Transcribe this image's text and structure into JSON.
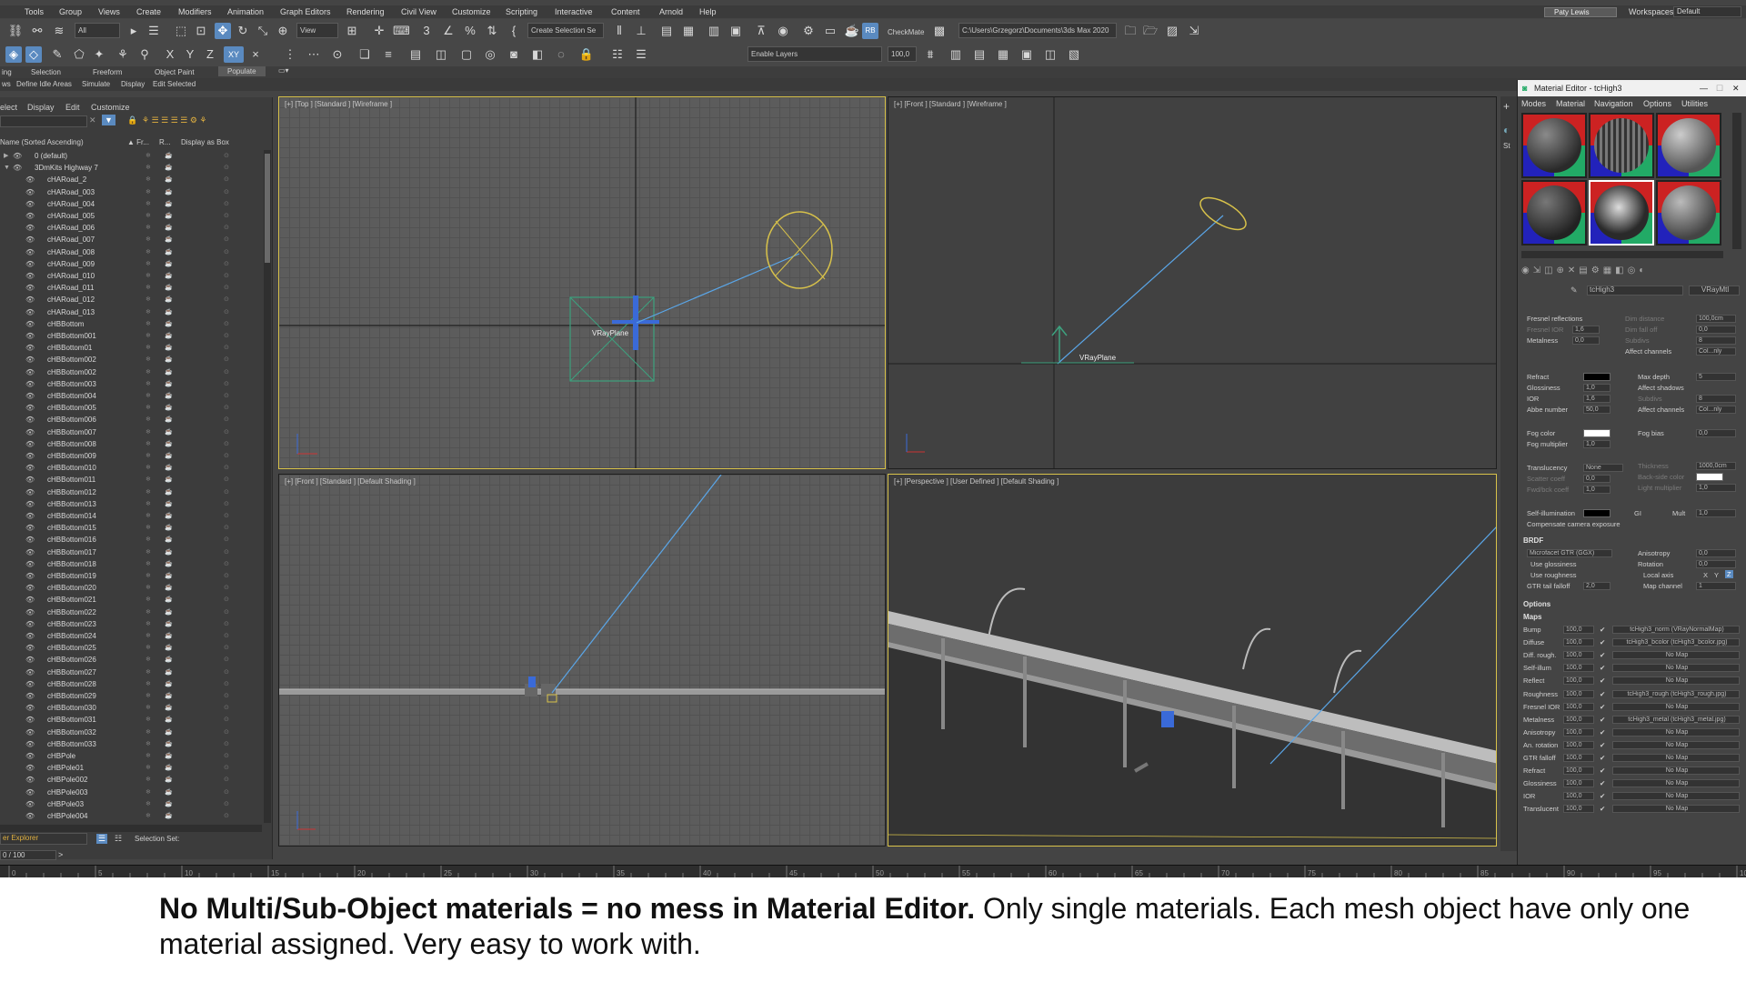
{
  "menu": [
    "Tools",
    "Group",
    "Views",
    "Create",
    "Modifiers",
    "Animation",
    "Graph Editors",
    "Rendering",
    "Civil View",
    "Customize",
    "Scripting",
    "Interactive",
    "Content",
    "Arnold",
    "Help"
  ],
  "user": {
    "name": "Paty Lewis",
    "workspaces_label": "Workspaces:",
    "workspace": "Default"
  },
  "toolbar": {
    "filter": "All",
    "view": "View",
    "selection_set": "Create Selection Se",
    "checkmate": "CheckMate",
    "path": "C:\\Users\\Grzegorz\\Documents\\3ds Max 2020",
    "enable_layers": "Enable Layers",
    "value": "100,0",
    "xyz": [
      "X",
      "Y",
      "Z",
      "XY"
    ]
  },
  "ribbon": {
    "tabs": [
      "ing",
      "Selection",
      "Freeform",
      "Object Paint",
      "Populate"
    ],
    "sub": [
      "ws",
      "Define Idle Areas",
      "Simulate",
      "Display",
      "Edit Selected"
    ]
  },
  "scene": {
    "tabs": [
      "elect",
      "Display",
      "Edit",
      "Customize"
    ],
    "headers": {
      "name": "Name (Sorted Ascending)",
      "fr": "▲ Fr...",
      "r": "R...",
      "display": "Display as Box"
    },
    "rows": [
      "0 (default)",
      "3DmKits Highway 7",
      "cHARoad_2",
      "cHARoad_003",
      "cHARoad_004",
      "cHARoad_005",
      "cHARoad_006",
      "cHARoad_007",
      "cHARoad_008",
      "cHARoad_009",
      "cHARoad_010",
      "cHARoad_011",
      "cHARoad_012",
      "cHARoad_013",
      "cHBBottom",
      "cHBBottom001",
      "cHBBottom01",
      "cHBBottom002",
      "cHBBottom002",
      "cHBBottom003",
      "cHBBottom004",
      "cHBBottom005",
      "cHBBottom006",
      "cHBBottom007",
      "cHBBottom008",
      "cHBBottom009",
      "cHBBottom010",
      "cHBBottom011",
      "cHBBottom012",
      "cHBBottom013",
      "cHBBottom014",
      "cHBBottom015",
      "cHBBottom016",
      "cHBBottom017",
      "cHBBottom018",
      "cHBBottom019",
      "cHBBottom020",
      "cHBBottom021",
      "cHBBottom022",
      "cHBBottom023",
      "cHBBottom024",
      "cHBBottom025",
      "cHBBottom026",
      "cHBBottom027",
      "cHBBottom028",
      "cHBBottom029",
      "cHBBottom030",
      "cHBBottom031",
      "cHBBottom032",
      "cHBBottom033",
      "cHBPole",
      "cHBPole01",
      "cHBPole002",
      "cHBPole003",
      "cHBPole03",
      "cHBPole004"
    ],
    "footer": "er Explorer",
    "selection_set": "Selection Set:",
    "frame": "0 / 100"
  },
  "viewports": {
    "top": "[+] [Top ] [Standard ] [Wireframe ]",
    "front_wire": "[+] [Front ] [Standard ] [Wireframe ]",
    "front_shaded": "[+] [Front ] [Standard ] [Default Shading ]",
    "persp": "[+] [Perspective ] [User Defined ] [Default Shading ]",
    "vrayplane": "VRayPlane"
  },
  "material_editor": {
    "title": "Material Editor - tcHigh3",
    "menus": [
      "Modes",
      "Material",
      "Navigation",
      "Options",
      "Utilities"
    ],
    "mat_name": "tcHigh3",
    "mat_type": "VRayMtl",
    "labels": {
      "fresnel": "Fresnel reflections",
      "fresnel_ior": "Fresnel IOR",
      "metalness": "Metalness",
      "dim_distance": "Dim distance",
      "dim_falloff": "Dim fall off",
      "subdivs": "Subdivs",
      "affect_channels": "Affect channels",
      "refract": "Refract",
      "glossiness": "Glossiness",
      "ior": "IOR",
      "abbe": "Abbe number",
      "max_depth": "Max depth",
      "affect_shadows": "Affect shadows",
      "fog_color": "Fog color",
      "fog_mult": "Fog multiplier",
      "fog_bias": "Fog bias",
      "translucency": "Translucency",
      "scatter": "Scatter coeff",
      "fwd_bck": "Fwd/bck coeff",
      "thickness": "Thickness",
      "back_side": "Back-side color",
      "light_mult": "Light multiplier",
      "self_illum": "Self-illumination",
      "gi": "GI",
      "mult": "Mult",
      "comp_cam": "Compensate camera exposure",
      "brdf": "BRDF",
      "brdf_type": "Microfacet GTR (GGX)",
      "use_gloss": "Use glossiness",
      "use_rough": "Use roughness",
      "gtr_tail": "GTR tail falloff",
      "anisotropy": "Anisotropy",
      "rotation": "Rotation",
      "local_axis": "Local axis",
      "map_channel": "Map channel",
      "options": "Options",
      "maps": "Maps"
    },
    "values": {
      "fresnel_ior": "1,6",
      "metalness": "0,0",
      "dim": "100,0cm",
      "falloff": "0,0",
      "subdivs": "8",
      "col_only": "Col...nly",
      "gloss": "1,0",
      "ior": "1,6",
      "abbe": "50,0",
      "max_depth": "5",
      "fog_mult": "1,0",
      "fog_bias": "0,0",
      "transl": "None",
      "scatter": "0,0",
      "fwdbck": "1,0",
      "thick": "1000,0cm",
      "lightmult": "1,0",
      "mult": "1,0",
      "gtr": "2,0",
      "aniso": "0,0",
      "rot": "0,0",
      "mapch": "1",
      "xyz": [
        "X",
        "Y",
        "Z"
      ]
    },
    "maps": [
      [
        "Bump",
        "100,0",
        "tcHigh3_norm (VRayNormalMap)"
      ],
      [
        "Diffuse",
        "100,0",
        "tcHigh3_bcolor (tcHigh3_bcolor.jpg)"
      ],
      [
        "Diff. rough.",
        "100,0",
        "No Map"
      ],
      [
        "Self-illum",
        "100,0",
        "No Map"
      ],
      [
        "Reflect",
        "100,0",
        "No Map"
      ],
      [
        "Roughness",
        "100,0",
        "tcHigh3_rough (tcHigh3_rough.jpg)"
      ],
      [
        "Fresnel IOR",
        "100,0",
        "No Map"
      ],
      [
        "Metalness",
        "100,0",
        "tcHigh3_metal (tcHigh3_metal.jpg)"
      ],
      [
        "Anisotropy",
        "100,0",
        "No Map"
      ],
      [
        "An. rotation",
        "100,0",
        "No Map"
      ],
      [
        "GTR falloff",
        "100,0",
        "No Map"
      ],
      [
        "Refract",
        "100,0",
        "No Map"
      ],
      [
        "Glossiness",
        "100,0",
        "No Map"
      ],
      [
        "IOR",
        "100,0",
        "No Map"
      ],
      [
        "Translucent",
        "100,0",
        "No Map"
      ]
    ]
  },
  "timeline": {
    "ticks": [
      "0",
      "5",
      "10",
      "15",
      "20",
      "25",
      "30",
      "35",
      "40",
      "45",
      "50",
      "55",
      "60",
      "65",
      "70",
      "75",
      "80",
      "85",
      "90",
      "95",
      "100"
    ]
  },
  "caption": {
    "bold": "No Multi/Sub-Object materials = no mess in Material Editor.",
    "rest": " Only single materials. Each mesh object have only one material assigned. Very easy to work with."
  },
  "colors": {
    "accent": "#5a8ac0",
    "viewport_active": "#d8c24a",
    "light_line": "#5aa6e8"
  }
}
